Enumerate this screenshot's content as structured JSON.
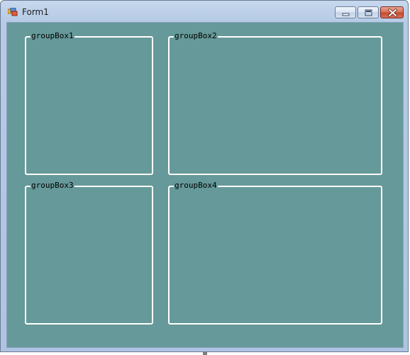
{
  "window": {
    "title": "Form1",
    "icon": "winforms-app-icon",
    "controls": {
      "minimize": "minimize-icon",
      "maximize": "maximize-icon",
      "close": "close-icon"
    }
  },
  "colors": {
    "client_background": "#669999",
    "groupbox_border": "#ffffff",
    "caption_text": "#000000"
  },
  "groupboxes": [
    {
      "label": "groupBox1"
    },
    {
      "label": "groupBox2"
    },
    {
      "label": "groupBox3"
    },
    {
      "label": "groupBox4"
    }
  ]
}
